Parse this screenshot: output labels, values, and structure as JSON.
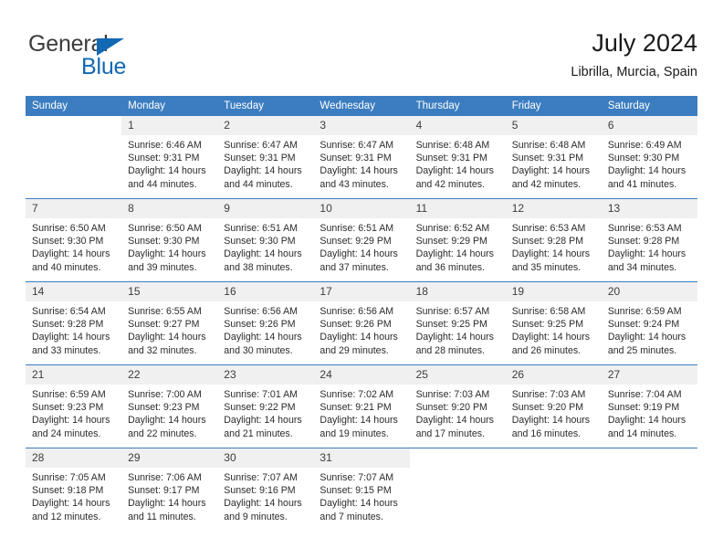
{
  "brand": {
    "name_top": "General",
    "name_bottom": "Blue",
    "accent_color": "#1268b3"
  },
  "header": {
    "title": "July 2024",
    "subtitle": "Librilla, Murcia, Spain"
  },
  "calendar": {
    "header_color": "#3b7dc0",
    "weekdays": [
      "Sunday",
      "Monday",
      "Tuesday",
      "Wednesday",
      "Thursday",
      "Friday",
      "Saturday"
    ],
    "weeks": [
      [
        {
          "day": "",
          "sunrise": "",
          "sunset": "",
          "daylight1": "",
          "daylight2": ""
        },
        {
          "day": "1",
          "sunrise": "Sunrise: 6:46 AM",
          "sunset": "Sunset: 9:31 PM",
          "daylight1": "Daylight: 14 hours",
          "daylight2": "and 44 minutes."
        },
        {
          "day": "2",
          "sunrise": "Sunrise: 6:47 AM",
          "sunset": "Sunset: 9:31 PM",
          "daylight1": "Daylight: 14 hours",
          "daylight2": "and 44 minutes."
        },
        {
          "day": "3",
          "sunrise": "Sunrise: 6:47 AM",
          "sunset": "Sunset: 9:31 PM",
          "daylight1": "Daylight: 14 hours",
          "daylight2": "and 43 minutes."
        },
        {
          "day": "4",
          "sunrise": "Sunrise: 6:48 AM",
          "sunset": "Sunset: 9:31 PM",
          "daylight1": "Daylight: 14 hours",
          "daylight2": "and 42 minutes."
        },
        {
          "day": "5",
          "sunrise": "Sunrise: 6:48 AM",
          "sunset": "Sunset: 9:31 PM",
          "daylight1": "Daylight: 14 hours",
          "daylight2": "and 42 minutes."
        },
        {
          "day": "6",
          "sunrise": "Sunrise: 6:49 AM",
          "sunset": "Sunset: 9:30 PM",
          "daylight1": "Daylight: 14 hours",
          "daylight2": "and 41 minutes."
        }
      ],
      [
        {
          "day": "7",
          "sunrise": "Sunrise: 6:50 AM",
          "sunset": "Sunset: 9:30 PM",
          "daylight1": "Daylight: 14 hours",
          "daylight2": "and 40 minutes."
        },
        {
          "day": "8",
          "sunrise": "Sunrise: 6:50 AM",
          "sunset": "Sunset: 9:30 PM",
          "daylight1": "Daylight: 14 hours",
          "daylight2": "and 39 minutes."
        },
        {
          "day": "9",
          "sunrise": "Sunrise: 6:51 AM",
          "sunset": "Sunset: 9:30 PM",
          "daylight1": "Daylight: 14 hours",
          "daylight2": "and 38 minutes."
        },
        {
          "day": "10",
          "sunrise": "Sunrise: 6:51 AM",
          "sunset": "Sunset: 9:29 PM",
          "daylight1": "Daylight: 14 hours",
          "daylight2": "and 37 minutes."
        },
        {
          "day": "11",
          "sunrise": "Sunrise: 6:52 AM",
          "sunset": "Sunset: 9:29 PM",
          "daylight1": "Daylight: 14 hours",
          "daylight2": "and 36 minutes."
        },
        {
          "day": "12",
          "sunrise": "Sunrise: 6:53 AM",
          "sunset": "Sunset: 9:28 PM",
          "daylight1": "Daylight: 14 hours",
          "daylight2": "and 35 minutes."
        },
        {
          "day": "13",
          "sunrise": "Sunrise: 6:53 AM",
          "sunset": "Sunset: 9:28 PM",
          "daylight1": "Daylight: 14 hours",
          "daylight2": "and 34 minutes."
        }
      ],
      [
        {
          "day": "14",
          "sunrise": "Sunrise: 6:54 AM",
          "sunset": "Sunset: 9:28 PM",
          "daylight1": "Daylight: 14 hours",
          "daylight2": "and 33 minutes."
        },
        {
          "day": "15",
          "sunrise": "Sunrise: 6:55 AM",
          "sunset": "Sunset: 9:27 PM",
          "daylight1": "Daylight: 14 hours",
          "daylight2": "and 32 minutes."
        },
        {
          "day": "16",
          "sunrise": "Sunrise: 6:56 AM",
          "sunset": "Sunset: 9:26 PM",
          "daylight1": "Daylight: 14 hours",
          "daylight2": "and 30 minutes."
        },
        {
          "day": "17",
          "sunrise": "Sunrise: 6:56 AM",
          "sunset": "Sunset: 9:26 PM",
          "daylight1": "Daylight: 14 hours",
          "daylight2": "and 29 minutes."
        },
        {
          "day": "18",
          "sunrise": "Sunrise: 6:57 AM",
          "sunset": "Sunset: 9:25 PM",
          "daylight1": "Daylight: 14 hours",
          "daylight2": "and 28 minutes."
        },
        {
          "day": "19",
          "sunrise": "Sunrise: 6:58 AM",
          "sunset": "Sunset: 9:25 PM",
          "daylight1": "Daylight: 14 hours",
          "daylight2": "and 26 minutes."
        },
        {
          "day": "20",
          "sunrise": "Sunrise: 6:59 AM",
          "sunset": "Sunset: 9:24 PM",
          "daylight1": "Daylight: 14 hours",
          "daylight2": "and 25 minutes."
        }
      ],
      [
        {
          "day": "21",
          "sunrise": "Sunrise: 6:59 AM",
          "sunset": "Sunset: 9:23 PM",
          "daylight1": "Daylight: 14 hours",
          "daylight2": "and 24 minutes."
        },
        {
          "day": "22",
          "sunrise": "Sunrise: 7:00 AM",
          "sunset": "Sunset: 9:23 PM",
          "daylight1": "Daylight: 14 hours",
          "daylight2": "and 22 minutes."
        },
        {
          "day": "23",
          "sunrise": "Sunrise: 7:01 AM",
          "sunset": "Sunset: 9:22 PM",
          "daylight1": "Daylight: 14 hours",
          "daylight2": "and 21 minutes."
        },
        {
          "day": "24",
          "sunrise": "Sunrise: 7:02 AM",
          "sunset": "Sunset: 9:21 PM",
          "daylight1": "Daylight: 14 hours",
          "daylight2": "and 19 minutes."
        },
        {
          "day": "25",
          "sunrise": "Sunrise: 7:03 AM",
          "sunset": "Sunset: 9:20 PM",
          "daylight1": "Daylight: 14 hours",
          "daylight2": "and 17 minutes."
        },
        {
          "day": "26",
          "sunrise": "Sunrise: 7:03 AM",
          "sunset": "Sunset: 9:20 PM",
          "daylight1": "Daylight: 14 hours",
          "daylight2": "and 16 minutes."
        },
        {
          "day": "27",
          "sunrise": "Sunrise: 7:04 AM",
          "sunset": "Sunset: 9:19 PM",
          "daylight1": "Daylight: 14 hours",
          "daylight2": "and 14 minutes."
        }
      ],
      [
        {
          "day": "28",
          "sunrise": "Sunrise: 7:05 AM",
          "sunset": "Sunset: 9:18 PM",
          "daylight1": "Daylight: 14 hours",
          "daylight2": "and 12 minutes."
        },
        {
          "day": "29",
          "sunrise": "Sunrise: 7:06 AM",
          "sunset": "Sunset: 9:17 PM",
          "daylight1": "Daylight: 14 hours",
          "daylight2": "and 11 minutes."
        },
        {
          "day": "30",
          "sunrise": "Sunrise: 7:07 AM",
          "sunset": "Sunset: 9:16 PM",
          "daylight1": "Daylight: 14 hours",
          "daylight2": "and 9 minutes."
        },
        {
          "day": "31",
          "sunrise": "Sunrise: 7:07 AM",
          "sunset": "Sunset: 9:15 PM",
          "daylight1": "Daylight: 14 hours",
          "daylight2": "and 7 minutes."
        },
        {
          "day": "",
          "sunrise": "",
          "sunset": "",
          "daylight1": "",
          "daylight2": ""
        },
        {
          "day": "",
          "sunrise": "",
          "sunset": "",
          "daylight1": "",
          "daylight2": ""
        },
        {
          "day": "",
          "sunrise": "",
          "sunset": "",
          "daylight1": "",
          "daylight2": ""
        }
      ]
    ]
  }
}
